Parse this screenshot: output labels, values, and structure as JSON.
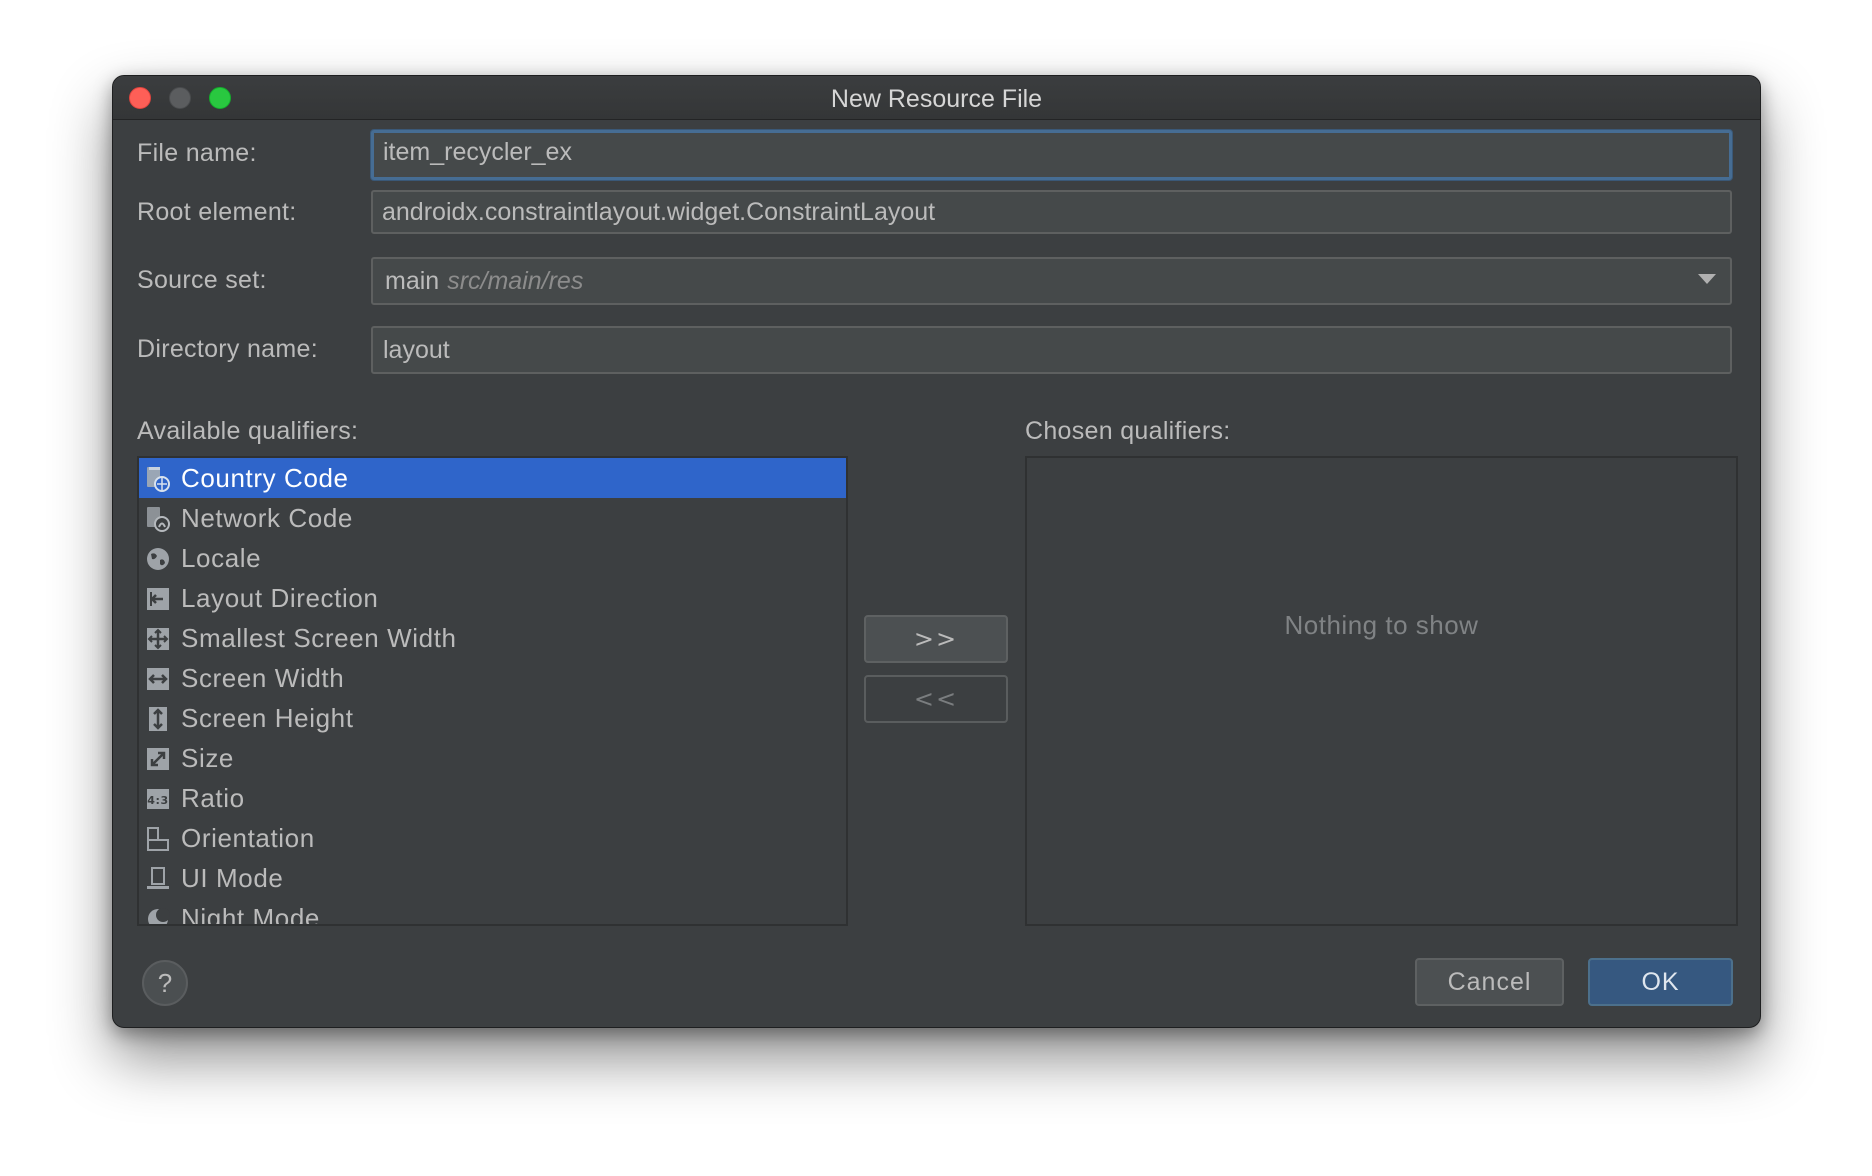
{
  "window": {
    "title": "New Resource File"
  },
  "form": {
    "file_name_label": "File name:",
    "file_name_value": "item_recycler_ex",
    "root_element_label": "Root element:",
    "root_element_value": "androidx.constraintlayout.widget.ConstraintLayout",
    "source_set_label": "Source set:",
    "source_set_value": "main",
    "source_set_path": "src/main/res",
    "directory_name_label": "Directory name:",
    "directory_name_value": "layout"
  },
  "available": {
    "label": "Available qualifiers:",
    "items": [
      {
        "label": "Country Code",
        "icon": "country-code-icon",
        "selected": true
      },
      {
        "label": "Network Code",
        "icon": "network-code-icon"
      },
      {
        "label": "Locale",
        "icon": "globe-icon"
      },
      {
        "label": "Layout Direction",
        "icon": "layout-direction-icon"
      },
      {
        "label": "Smallest Screen Width",
        "icon": "smallest-screen-width-icon"
      },
      {
        "label": "Screen Width",
        "icon": "screen-width-icon"
      },
      {
        "label": "Screen Height",
        "icon": "screen-height-icon"
      },
      {
        "label": "Size",
        "icon": "size-icon"
      },
      {
        "label": "Ratio",
        "icon": "ratio-icon"
      },
      {
        "label": "Orientation",
        "icon": "orientation-icon"
      },
      {
        "label": "UI Mode",
        "icon": "ui-mode-icon"
      },
      {
        "label": "Night Mode",
        "icon": "night-mode-icon"
      }
    ]
  },
  "transfer": {
    "add_label": ">>",
    "remove_label": "<<"
  },
  "chosen": {
    "label": "Chosen qualifiers:",
    "empty_text": "Nothing to show"
  },
  "footer": {
    "help_label": "?",
    "cancel_label": "Cancel",
    "ok_label": "OK"
  },
  "colors": {
    "selection": "#2f65ca",
    "ok_button": "#365880",
    "background": "#3c3f41"
  }
}
